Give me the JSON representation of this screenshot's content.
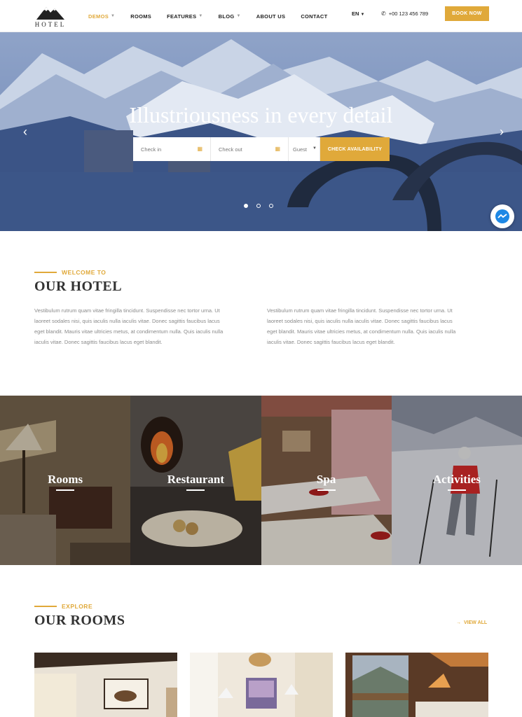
{
  "header": {
    "logo_text": "HOTEL",
    "nav": [
      {
        "label": "DEMOS",
        "dropdown": true,
        "active": true
      },
      {
        "label": "ROOMS",
        "dropdown": false,
        "active": false
      },
      {
        "label": "FEATURES",
        "dropdown": true,
        "active": false
      },
      {
        "label": "BLOG",
        "dropdown": true,
        "active": false
      },
      {
        "label": "ABOUT US",
        "dropdown": false,
        "active": false
      },
      {
        "label": "CONTACT",
        "dropdown": false,
        "active": false
      }
    ],
    "language": "EN",
    "phone": "+00 123 456 789",
    "book_label": "BOOK NOW"
  },
  "hero": {
    "title": "Illustriousness in every detail",
    "search": {
      "checkin_placeholder": "Check in",
      "checkout_placeholder": "Check out",
      "guest_placeholder": "Guest",
      "button_label": "CHECK AVAILABILITY"
    },
    "slides_total": 3,
    "active_slide": 1
  },
  "welcome": {
    "kicker": "WELCOME TO",
    "title": "OUR HOTEL",
    "paragraph_left": "Vestibulum rutrum quam vitae fringilla tincidunt. Suspendisse nec tortor urna. Ut laoreet sodales nisi, quis iaculis nulla iaculis vitae. Donec sagittis faucibus lacus eget blandit. Mauris vitae ultricies metus, at condimentum nulla. Quis iaculis nulla iaculis vitae. Donec sagittis faucibus lacus eget blandit.",
    "paragraph_right": "Vestibulum rutrum quam vitae fringilla tincidunt. Suspendisse nec tortor urna. Ut laoreet sodales nisi, quis iaculis nulla iaculis vitae. Donec sagittis faucibus lacus eget blandit. Mauris vitae ultricies metus, at condimentum nulla. Quis iaculis nulla iaculis vitae. Donec sagittis faucibus lacus eget blandit."
  },
  "tiles": [
    {
      "label": "Rooms"
    },
    {
      "label": "Restaurant"
    },
    {
      "label": "Spa"
    },
    {
      "label": "Activities"
    }
  ],
  "explore": {
    "kicker": "EXPLORE",
    "title": "OUR ROOMS",
    "view_all": "VIEW ALL"
  },
  "colors": {
    "accent": "#e0a93a",
    "text_dark": "#333333",
    "text_muted": "#8a8a8a"
  }
}
